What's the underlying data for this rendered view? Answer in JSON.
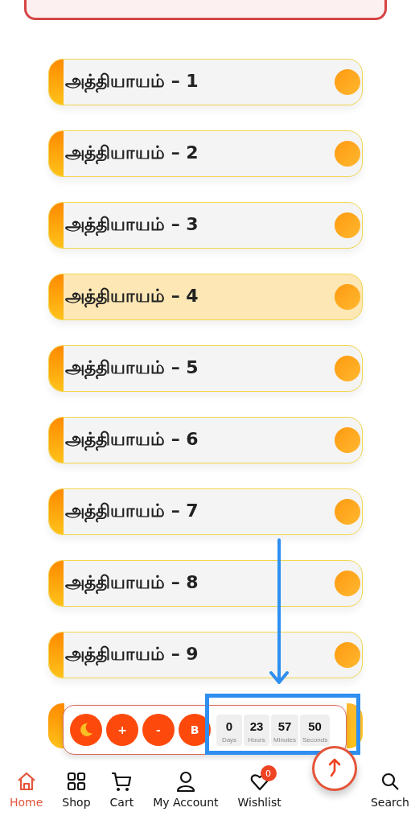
{
  "chapters": [
    {
      "title": "அத்தியாயம் – 1",
      "selected": false
    },
    {
      "title": "அத்தியாயம் – 2",
      "selected": false
    },
    {
      "title": "அத்தியாயம் – 3",
      "selected": false
    },
    {
      "title": "அத்தியாயம் – 4",
      "selected": true
    },
    {
      "title": "அத்தியாயம் – 5",
      "selected": false
    },
    {
      "title": "அத்தியாயம் – 6",
      "selected": false
    },
    {
      "title": "அத்தியாயம் – 7",
      "selected": false
    },
    {
      "title": "அத்தியாயம் – 8",
      "selected": false
    },
    {
      "title": "அத்தியாயம் – 9",
      "selected": false
    }
  ],
  "reader_toolbar": {
    "buttons": [
      {
        "kind": "moon"
      },
      {
        "kind": "text",
        "label": "+"
      },
      {
        "kind": "text",
        "label": "-"
      },
      {
        "kind": "text",
        "label": "B"
      }
    ],
    "countdown": [
      {
        "value": "0",
        "unit": "Days"
      },
      {
        "value": "23",
        "unit": "Hours"
      },
      {
        "value": "57",
        "unit": "Minutes"
      },
      {
        "value": "50",
        "unit": "Seconds"
      }
    ],
    "highlighted": true
  },
  "bottom_nav": [
    {
      "kind": "home",
      "label": "Home",
      "selected": true
    },
    {
      "kind": "shop",
      "label": "Shop",
      "selected": false
    },
    {
      "kind": "cart",
      "label": "Cart",
      "selected": false
    },
    {
      "kind": "account",
      "label": "My Account",
      "selected": false
    },
    {
      "kind": "wishlist",
      "label": "Wishlist",
      "selected": false,
      "badge": "0"
    },
    {
      "kind": "search",
      "label": "Search",
      "selected": false
    }
  ],
  "scroll_to_top": true
}
